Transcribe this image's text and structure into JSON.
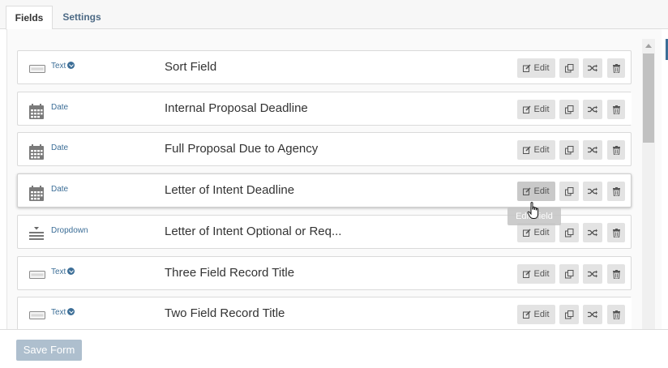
{
  "tabs": [
    {
      "label": "Fields",
      "active": true
    },
    {
      "label": "Settings",
      "active": false
    }
  ],
  "actions": {
    "edit_label": "Edit"
  },
  "tooltip": "Edit Field",
  "rows": [
    {
      "type": "Text",
      "type_icon": "text-field-icon",
      "has_chevron": true,
      "name": "Sort Field"
    },
    {
      "type": "Date",
      "type_icon": "calendar-icon",
      "has_chevron": false,
      "name": "Internal Proposal Deadline"
    },
    {
      "type": "Date",
      "type_icon": "calendar-icon",
      "has_chevron": false,
      "name": "Full Proposal Due to Agency"
    },
    {
      "type": "Date",
      "type_icon": "calendar-icon",
      "has_chevron": false,
      "name": "Letter of Intent Deadline",
      "hovered": true
    },
    {
      "type": "Dropdown",
      "type_icon": "dropdown-list-icon",
      "has_chevron": false,
      "name": "Letter of Intent Optional or Req..."
    },
    {
      "type": "Text",
      "type_icon": "text-field-icon",
      "has_chevron": true,
      "name": "Three Field Record Title"
    },
    {
      "type": "Text",
      "type_icon": "text-field-icon",
      "has_chevron": true,
      "name": "Two Field Record Title"
    }
  ],
  "footer": {
    "save_label": "Save Form"
  },
  "colors": {
    "accent": "#3c6e97",
    "save_button": "#aebfce",
    "button_bg": "#e3e3e3"
  }
}
